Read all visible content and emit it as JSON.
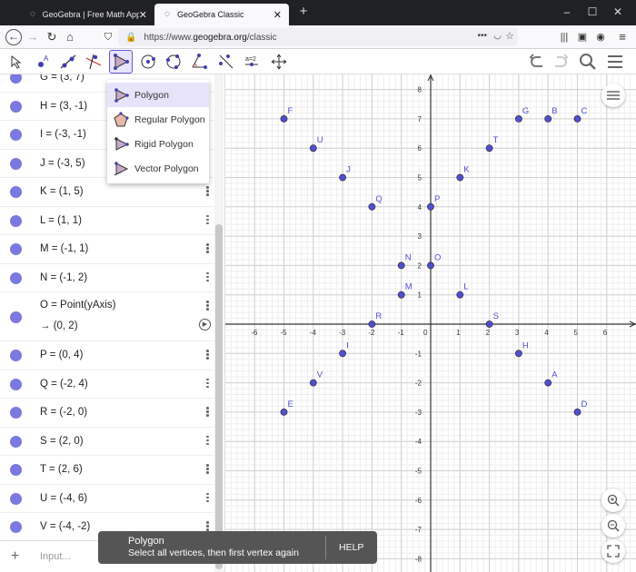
{
  "browser": {
    "tabs": [
      {
        "label": "GeoGebra | Free Math Apps - u",
        "active": false
      },
      {
        "label": "GeoGebra Classic",
        "active": true
      }
    ],
    "url_prefix": "https://www.",
    "url_host": "geogebra.org",
    "url_path": "/classic"
  },
  "algebra": {
    "rows": [
      {
        "text": "G = (3, 7)"
      },
      {
        "text": "H = (3, -1)"
      },
      {
        "text": "I = (-3, -1)"
      },
      {
        "text": "J = (-3, 5)"
      },
      {
        "text": "K = (1, 5)"
      },
      {
        "text": "L = (1, 1)"
      },
      {
        "text": "M = (-1, 1)"
      },
      {
        "text": "N = (-1, 2)"
      },
      {
        "text": "O = Point(yAxis)",
        "value": "→  (0, 2)"
      },
      {
        "text": "P = (0, 4)"
      },
      {
        "text": "Q = (-2, 4)"
      },
      {
        "text": "R = (-2, 0)"
      },
      {
        "text": "S = (2, 0)"
      },
      {
        "text": "T = (2, 6)"
      },
      {
        "text": "U = (-4, 6)"
      },
      {
        "text": "V = (-4, -2)"
      }
    ],
    "input_placeholder": "Input..."
  },
  "popup": {
    "items": [
      "Polygon",
      "Regular Polygon",
      "Rigid Polygon",
      "Vector Polygon"
    ]
  },
  "tooltip": {
    "title": "Polygon",
    "message": "Select all vertices, then first vertex again",
    "help": "HELP"
  },
  "graph": {
    "x_ticks": [
      -6,
      -5,
      -4,
      -3,
      -2,
      -1,
      0,
      1,
      2,
      3,
      4,
      5,
      6
    ],
    "y_ticks": [
      8,
      7,
      6,
      5,
      4,
      3,
      2,
      1,
      -1,
      -2,
      -3,
      -4,
      -5,
      -6,
      -7,
      -8
    ],
    "points": [
      {
        "name": "A",
        "x": 4,
        "y": -2
      },
      {
        "name": "B",
        "x": 4,
        "y": 7
      },
      {
        "name": "C",
        "x": 5,
        "y": 7
      },
      {
        "name": "D",
        "x": 5,
        "y": -3
      },
      {
        "name": "E",
        "x": -5,
        "y": -3
      },
      {
        "name": "F",
        "x": -5,
        "y": 7
      },
      {
        "name": "G",
        "x": 3,
        "y": 7
      },
      {
        "name": "H",
        "x": 3,
        "y": -1
      },
      {
        "name": "I",
        "x": -3,
        "y": -1
      },
      {
        "name": "J",
        "x": -3,
        "y": 5
      },
      {
        "name": "K",
        "x": 1,
        "y": 5
      },
      {
        "name": "L",
        "x": 1,
        "y": 1
      },
      {
        "name": "M",
        "x": -1,
        "y": 1
      },
      {
        "name": "N",
        "x": -1,
        "y": 2
      },
      {
        "name": "O",
        "x": 0,
        "y": 2
      },
      {
        "name": "P",
        "x": 0,
        "y": 4
      },
      {
        "name": "Q",
        "x": -2,
        "y": 4
      },
      {
        "name": "R",
        "x": -2,
        "y": 0
      },
      {
        "name": "S",
        "x": 2,
        "y": 0
      },
      {
        "name": "T",
        "x": 2,
        "y": 6
      },
      {
        "name": "U",
        "x": -4,
        "y": 6
      },
      {
        "name": "V",
        "x": -4,
        "y": -2
      }
    ],
    "point_color": "#4f4fd0",
    "label_color": "#4f4fd0"
  }
}
